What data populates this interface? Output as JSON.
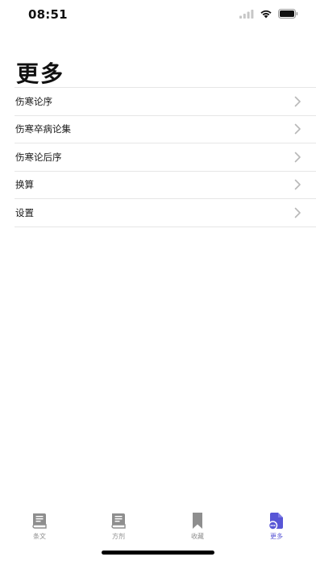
{
  "status_bar": {
    "time": "08:51",
    "icons": [
      "signal-icon",
      "wifi-icon",
      "battery-icon"
    ]
  },
  "page": {
    "title": "更多"
  },
  "menu": {
    "items": [
      {
        "label": "伤寒论序"
      },
      {
        "label": "伤寒卒病论集"
      },
      {
        "label": "伤寒论后序"
      },
      {
        "label": "换算"
      },
      {
        "label": "设置"
      }
    ]
  },
  "tab_bar": {
    "active_color": "#5856d6",
    "inactive_color": "#8e8e8e",
    "tabs": [
      {
        "label": "条文",
        "icon": "book-icon",
        "active": false
      },
      {
        "label": "方剂",
        "icon": "book-icon",
        "active": false
      },
      {
        "label": "收藏",
        "icon": "bookmark-icon",
        "active": false
      },
      {
        "label": "更多",
        "icon": "more-document-icon",
        "active": true
      }
    ]
  }
}
